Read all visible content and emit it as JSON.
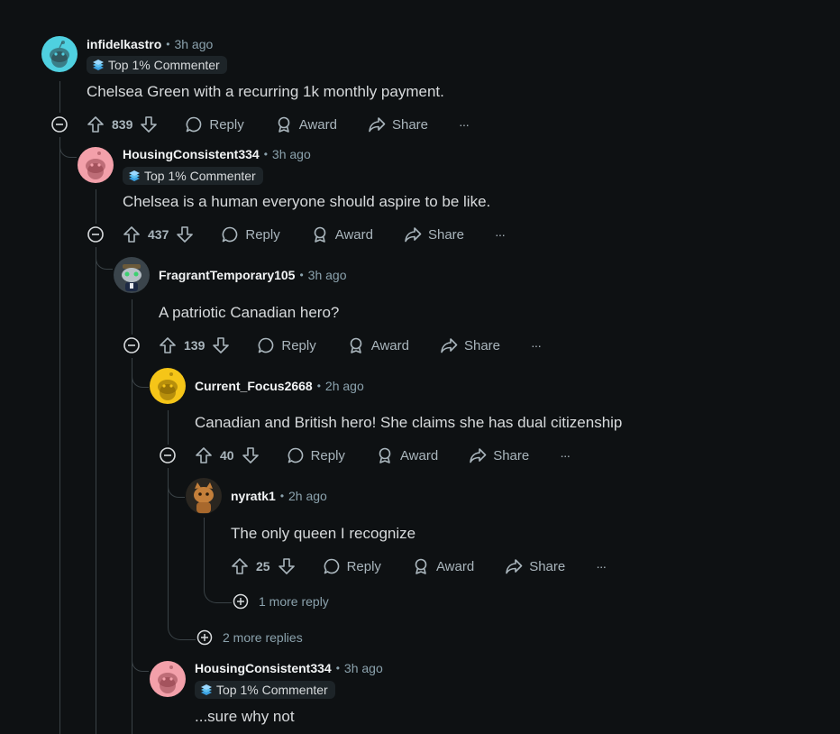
{
  "comments": [
    {
      "username": "infidelkastro",
      "time": "3h ago",
      "badge": "Top 1% Commenter",
      "text": "Chelsea Green with a recurring 1k monthly payment.",
      "votes": "839",
      "avatar_color": "#4fd0e0"
    },
    {
      "username": "HousingConsistent334",
      "time": "3h ago",
      "badge": "Top 1% Commenter",
      "text": "Chelsea is a human everyone should aspire to be like.",
      "votes": "437",
      "avatar_color": "#f3a0aa"
    },
    {
      "username": "FragrantTemporary105",
      "time": "3h ago",
      "text": "A patriotic Canadian hero?",
      "votes": "139",
      "avatar_color": "#5a6670"
    },
    {
      "username": "Current_Focus2668",
      "time": "2h ago",
      "text": "Canadian and British hero! She claims she has dual citizenship",
      "votes": "40",
      "avatar_color": "#f5c518"
    },
    {
      "username": "nyratk1",
      "time": "2h ago",
      "text": "The only queen I recognize",
      "votes": "25",
      "avatar_color": "#c47f3a"
    },
    {
      "username": "HousingConsistent334",
      "time": "3h ago",
      "badge": "Top 1% Commenter",
      "text": "...sure why not",
      "avatar_color": "#f3a0aa"
    }
  ],
  "labels": {
    "reply": "Reply",
    "award": "Award",
    "share": "Share",
    "overflow": "···"
  },
  "more": {
    "one_more": "1 more reply",
    "two_more": "2 more replies"
  },
  "colors": {
    "background": "#0e1113",
    "text": "#d7dadc",
    "muted": "#8ba2ad",
    "thread_line": "#3a4246"
  }
}
